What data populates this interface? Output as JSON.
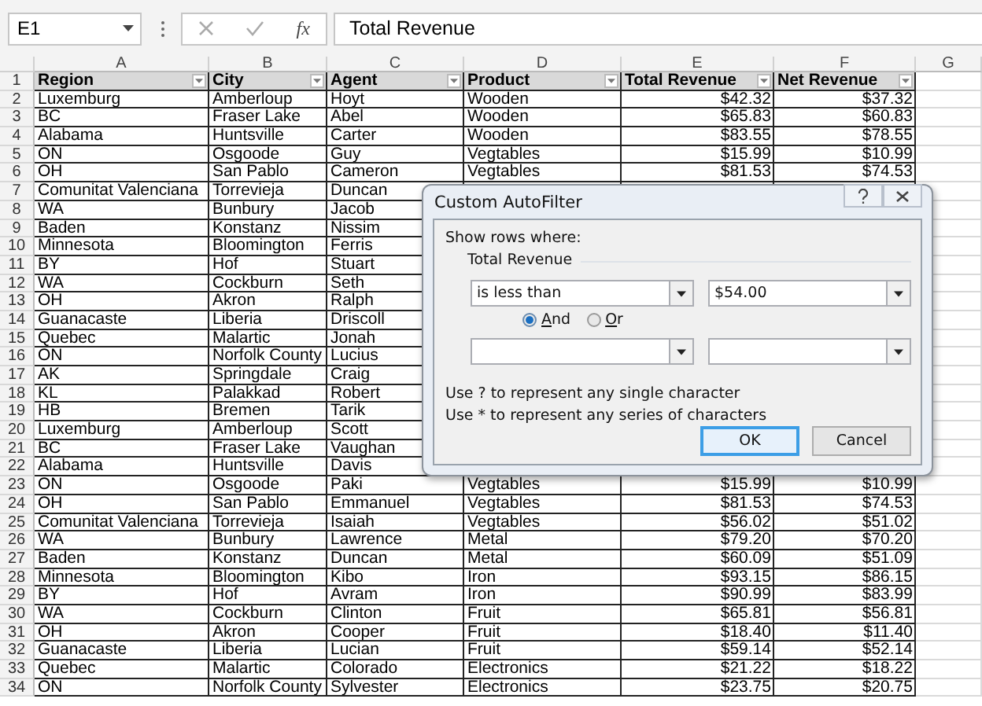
{
  "formula_bar": {
    "name_box": "E1",
    "function_label": "fx",
    "formula": "Total Revenue"
  },
  "columns": [
    {
      "letter": "A",
      "heading": "Region",
      "kind": "text"
    },
    {
      "letter": "B",
      "heading": "City",
      "kind": "text"
    },
    {
      "letter": "C",
      "heading": "Agent",
      "kind": "text"
    },
    {
      "letter": "D",
      "heading": "Product",
      "kind": "text"
    },
    {
      "letter": "E",
      "heading": "Total Revenue",
      "kind": "number"
    },
    {
      "letter": "F",
      "heading": "Net Revenue",
      "kind": "number"
    },
    {
      "letter": "G"
    }
  ],
  "header_row": "1",
  "rows": [
    {
      "number": "2",
      "cells": [
        "Luxemburg",
        "Amberloup",
        "Hoyt",
        "Wooden",
        "$42.32",
        "$37.32"
      ]
    },
    {
      "number": "3",
      "cells": [
        "BC",
        "Fraser Lake",
        "Abel",
        "Wooden",
        "$65.83",
        "$60.83"
      ]
    },
    {
      "number": "4",
      "cells": [
        "Alabama",
        "Huntsville",
        "Carter",
        "Wooden",
        "$83.55",
        "$78.55"
      ]
    },
    {
      "number": "5",
      "cells": [
        "ON",
        "Osgoode",
        "Guy",
        "Vegtables",
        "$15.99",
        "$10.99"
      ]
    },
    {
      "number": "6",
      "cells": [
        "OH",
        "San Pablo",
        "Cameron",
        "Vegtables",
        "$81.53",
        "$74.53"
      ]
    },
    {
      "number": "7",
      "cells": [
        "Comunitat Valenciana",
        "Torrevieja",
        "Duncan"
      ]
    },
    {
      "number": "8",
      "cells": [
        "WA",
        "Bunbury",
        "Jacob"
      ]
    },
    {
      "number": "9",
      "cells": [
        "Baden",
        "Konstanz",
        "Nissim"
      ]
    },
    {
      "number": "10",
      "cells": [
        "Minnesota",
        "Bloomington",
        "Ferris"
      ]
    },
    {
      "number": "11",
      "cells": [
        "BY",
        "Hof",
        "Stuart"
      ]
    },
    {
      "number": "12",
      "cells": [
        "WA",
        "Cockburn",
        "Seth"
      ]
    },
    {
      "number": "13",
      "cells": [
        "OH",
        "Akron",
        "Ralph"
      ]
    },
    {
      "number": "14",
      "cells": [
        "Guanacaste",
        "Liberia",
        "Driscoll"
      ]
    },
    {
      "number": "15",
      "cells": [
        "Quebec",
        "Malartic",
        "Jonah"
      ]
    },
    {
      "number": "16",
      "cells": [
        "ON",
        "Norfolk County",
        "Lucius"
      ]
    },
    {
      "number": "17",
      "cells": [
        "AK",
        "Springdale",
        "Craig"
      ]
    },
    {
      "number": "18",
      "cells": [
        "KL",
        "Palakkad",
        "Robert"
      ]
    },
    {
      "number": "19",
      "cells": [
        "HB",
        "Bremen",
        "Tarik"
      ]
    },
    {
      "number": "20",
      "cells": [
        "Luxemburg",
        "Amberloup",
        "Scott"
      ]
    },
    {
      "number": "21",
      "cells": [
        "BC",
        "Fraser Lake",
        "Vaughan"
      ]
    },
    {
      "number": "22",
      "cells": [
        "Alabama",
        "Huntsville",
        "Davis"
      ]
    },
    {
      "number": "23",
      "cells": [
        "ON",
        "Osgoode",
        "Paki",
        "Vegtables",
        "$15.99",
        "$10.99"
      ]
    },
    {
      "number": "24",
      "cells": [
        "OH",
        "San Pablo",
        "Emmanuel",
        "Vegtables",
        "$81.53",
        "$74.53"
      ]
    },
    {
      "number": "25",
      "cells": [
        "Comunitat Valenciana",
        "Torrevieja",
        "Isaiah",
        "Vegtables",
        "$56.02",
        "$51.02"
      ]
    },
    {
      "number": "26",
      "cells": [
        "WA",
        "Bunbury",
        "Lawrence",
        "Metal",
        "$79.20",
        "$70.20"
      ]
    },
    {
      "number": "27",
      "cells": [
        "Baden",
        "Konstanz",
        "Duncan",
        "Metal",
        "$60.09",
        "$51.09"
      ]
    },
    {
      "number": "28",
      "cells": [
        "Minnesota",
        "Bloomington",
        "Kibo",
        "Iron",
        "$93.15",
        "$86.15"
      ]
    },
    {
      "number": "29",
      "cells": [
        "BY",
        "Hof",
        "Avram",
        "Iron",
        "$90.99",
        "$83.99"
      ]
    },
    {
      "number": "30",
      "cells": [
        "WA",
        "Cockburn",
        "Clinton",
        "Fruit",
        "$65.81",
        "$56.81"
      ]
    },
    {
      "number": "31",
      "cells": [
        "OH",
        "Akron",
        "Cooper",
        "Fruit",
        "$18.40",
        "$11.40"
      ]
    },
    {
      "number": "32",
      "cells": [
        "Guanacaste",
        "Liberia",
        "Lucian",
        "Fruit",
        "$59.14",
        "$52.14"
      ]
    },
    {
      "number": "33",
      "cells": [
        "Quebec",
        "Malartic",
        "Colorado",
        "Electronics",
        "$21.22",
        "$18.22"
      ]
    },
    {
      "number": "34",
      "cells": [
        "ON",
        "Norfolk County",
        "Sylvester",
        "Electronics",
        "$23.75",
        "$20.75"
      ]
    }
  ],
  "dialog": {
    "title": "Custom AutoFilter",
    "prompt": "Show rows where:",
    "group_label": "Total Revenue",
    "criteria": [
      {
        "operator": "is less than",
        "value": "$54.00"
      }
    ],
    "join": [
      {
        "label": "And",
        "selected": true
      },
      {
        "label": "Or",
        "selected": false
      }
    ],
    "hints": [
      "Use ? to represent any single character",
      "Use * to represent any series of characters"
    ],
    "buttons": [
      {
        "label": "OK",
        "default": true
      },
      {
        "label": "Cancel",
        "default": false
      }
    ]
  }
}
